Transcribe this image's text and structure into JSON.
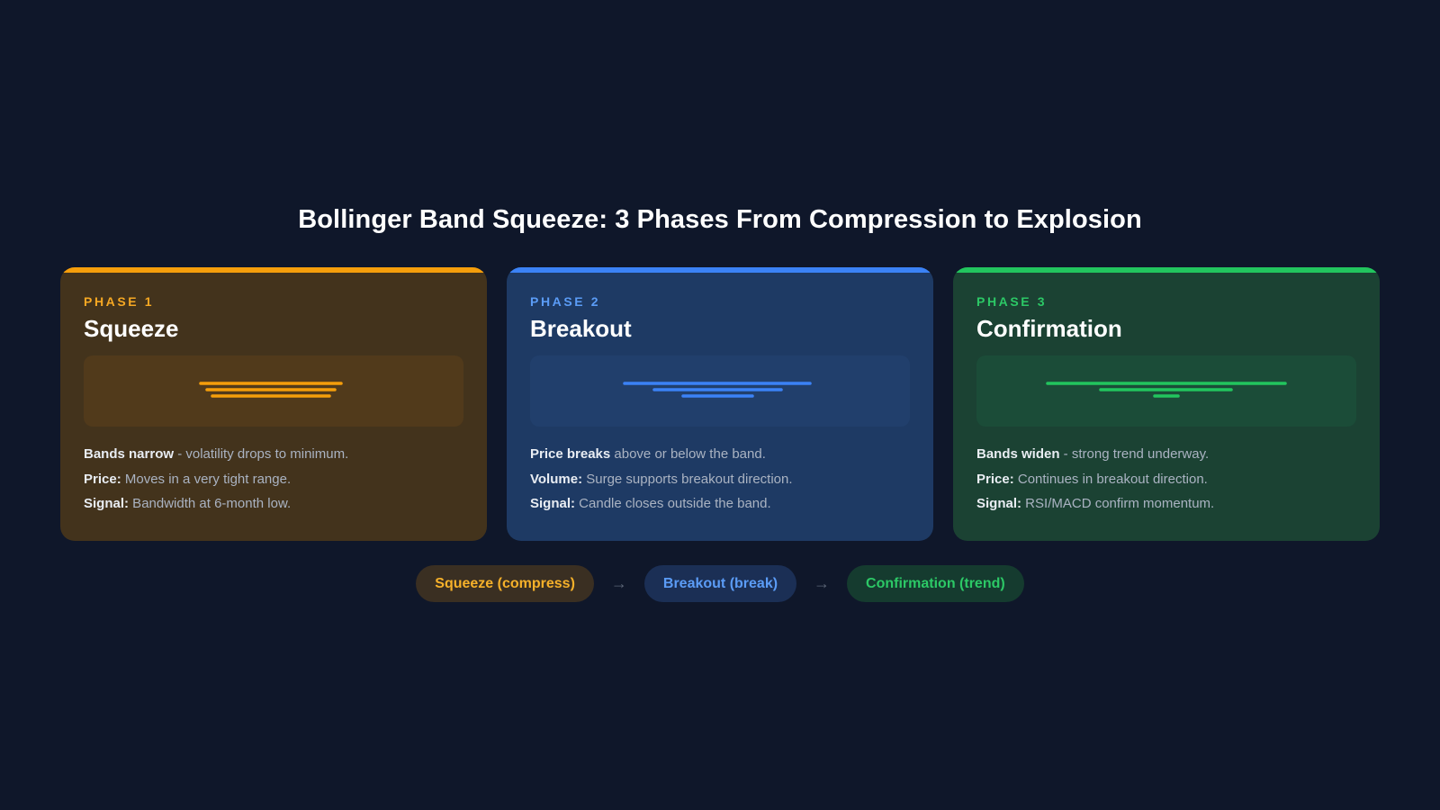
{
  "title": "Bollinger Band Squeeze: 3 Phases From Compression to Explosion",
  "phases": [
    {
      "phase_label": "PHASE 1",
      "name": "Squeeze",
      "accent": "#f59e0b",
      "lines": [
        {
          "bold": "Bands narrow",
          "text": " - volatility drops to minimum."
        },
        {
          "bold": "Price:",
          "text": " Moves in a very tight range."
        },
        {
          "bold": "Signal:",
          "text": " Bandwidth at 6-month low."
        }
      ]
    },
    {
      "phase_label": "PHASE 2",
      "name": "Breakout",
      "accent": "#3b82f6",
      "lines": [
        {
          "bold": "Price breaks",
          "text": " above or below the band."
        },
        {
          "bold": "Volume:",
          "text": " Surge supports breakout direction."
        },
        {
          "bold": "Signal:",
          "text": " Candle closes outside the band."
        }
      ]
    },
    {
      "phase_label": "PHASE 3",
      "name": "Confirmation",
      "accent": "#22c55e",
      "lines": [
        {
          "bold": "Bands widen",
          "text": " - strong trend underway."
        },
        {
          "bold": "Price:",
          "text": " Continues in breakout direction."
        },
        {
          "bold": "Signal:",
          "text": " RSI/MACD confirm momentum."
        }
      ]
    }
  ],
  "flow": [
    {
      "label": "Squeeze (compress)"
    },
    {
      "label": "Breakout (break)"
    },
    {
      "label": "Confirmation (trend)"
    }
  ],
  "flow_arrow": "→"
}
